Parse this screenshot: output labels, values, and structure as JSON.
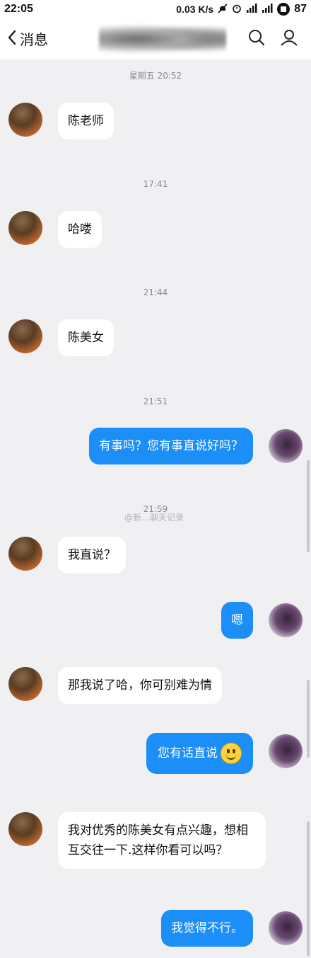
{
  "status_bar": {
    "time": "22:05",
    "speed": "0.03 K/s",
    "battery": "87"
  },
  "nav": {
    "back_label": "消息"
  },
  "watermark": "@新…聊天记录",
  "timestamps": {
    "t1": "星期五 20:52",
    "t2": "17:41",
    "t3": "21:44",
    "t4": "21:51",
    "t5": "21:59"
  },
  "messages": [
    {
      "side": "left",
      "text": "陈老师"
    },
    {
      "side": "left",
      "text": "哈喽"
    },
    {
      "side": "left",
      "text": "陈美女"
    },
    {
      "side": "right",
      "text": "有事吗？您有事直说好吗？"
    },
    {
      "side": "left",
      "text": "我直说？"
    },
    {
      "side": "right",
      "text": "嗯"
    },
    {
      "side": "left",
      "text": "那我说了哈，你可别难为情"
    },
    {
      "side": "right",
      "text": "您有话直说",
      "emoji": "smile-emoji"
    },
    {
      "side": "left",
      "text": "我对优秀的陈美女有点兴趣，想相互交往一下.这样你看可以吗？"
    },
    {
      "side": "right",
      "text": "我觉得不行。"
    }
  ],
  "colors": {
    "accent": "#1b8ef7",
    "background": "#f0f0f3"
  }
}
